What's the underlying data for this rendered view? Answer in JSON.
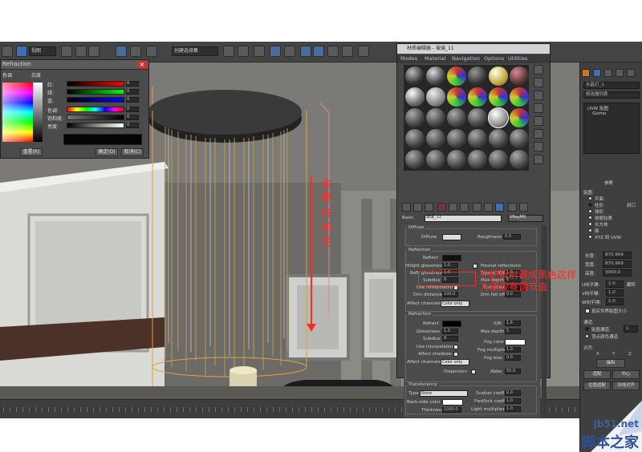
{
  "toolbar": {
    "view_dropdown": "视图",
    "selection_set_dropdown": "创建选择集"
  },
  "color_dialog": {
    "title": "Refraction",
    "label_hue": "色调",
    "label_whiteness": "白度",
    "labels": [
      "红:",
      "绿:",
      "蓝:",
      "色调:",
      "饱和度:",
      "亮度:"
    ],
    "values": [
      "0",
      "0",
      "0",
      "0",
      "0",
      "0"
    ],
    "reset_button": "重置(R)",
    "ok_button": "确定(O)",
    "cancel_button": "取消(C)"
  },
  "material_editor": {
    "title": "材质编辑器 - 玻璃_11",
    "menu": [
      "Modes",
      "Material",
      "Navigation",
      "Options",
      "Utilities"
    ],
    "material_name": "玻璃_11",
    "material_type": "VRayMtl",
    "name_label": "Basic",
    "diffuse_group": "Diffuse",
    "diffuse_label": "Diffuse",
    "roughness_label": "Roughness",
    "roughness_value": "0.0",
    "reflection_group": "Reflection",
    "reflect_label": "Reflect",
    "hilight_gloss_label": "Hilight glossiness",
    "hilight_gloss_value": "1.0",
    "refl_gloss_label": "Refl. glossiness",
    "refl_gloss_value": "1.0",
    "subdivs_label": "Subdivs",
    "subdivs_value": "8",
    "use_interp_label": "Use interpolation",
    "dim_distance_label": "Dim distance",
    "dim_distance_value": "100.0",
    "affect_channels_label": "Affect channels",
    "affect_channels_value": "Color only",
    "fresnel_label": "Fresnel reflections",
    "fresnel_ior_label": "Fresnel IOR",
    "fresnel_ior_value": "1.6",
    "max_depth_label": "Max depth",
    "max_depth_value": "5",
    "exit_color_label": "Exit color",
    "dim_falloff_label": "Dim fall off",
    "dim_falloff_value": "0.0",
    "refraction_group": "Refraction",
    "refract_label": "Refract",
    "glossiness_label": "Glossiness",
    "glossiness_value": "1.0",
    "ior_label": "IOR",
    "ior_value": "1.6",
    "refr_max_depth_value": "5",
    "refr_subdivs_value": "8",
    "refr_use_interp_label": "Use interpolation",
    "affect_shadows_label": "Affect shadows",
    "refr_affect_channels_label": "Affect channels",
    "refr_affect_channels_value": "Color only",
    "dispersion_label": "Dispersion",
    "fog_color_label": "Fog color",
    "fog_multiplier_label": "Fog multiplier",
    "fog_multiplier_value": "1.0",
    "fog_bias_label": "Fog bias",
    "fog_bias_value": "0.0",
    "abbe_label": "Abbe",
    "abbe_value": "50.0",
    "translucency_group": "Translucency",
    "type_label": "Type",
    "type_value": "None",
    "backside_color_label": "Back-side color",
    "thickness_label": "Thickness",
    "thickness_value": "1000.0",
    "scatter_coeff_label": "Scatter coeff",
    "scatter_coeff_value": "0.0",
    "fwd_bck_label": "Fwd/bck coeff",
    "fwd_bck_value": "1.0",
    "light_mult_label": "Light multiplier",
    "light_mult_value": "1.0"
  },
  "command_panel": {
    "object_name": "水晶灯_1",
    "modifier_list": "修改器列表",
    "stack_items": [
      "UVW 贴图",
      "Gizmo"
    ],
    "params_header": "参数",
    "mapping_label": "贴图:",
    "mapping_options": [
      "平面",
      "柱形",
      "封口",
      "球形",
      "收缩包裹",
      "长方体",
      "面",
      "XYZ 到 UVW"
    ],
    "length_label": "长度:",
    "length_value": "870.969",
    "width_label": "宽度:",
    "width_value": "870.969",
    "height_label": "高度:",
    "height_value": "3000.0",
    "u_tile_label": "U向平铺:",
    "v_tile_label": "V向平铺:",
    "w_tile_label": "W向平铺:",
    "tile_value": "1.0",
    "flip_label": "翻转",
    "real_world_label": "真实世界贴图大小",
    "channel_header": "通道:",
    "map_channel_label": "贴图通道:",
    "map_channel_value": "1",
    "vertex_channel_label": "顶点颜色通道",
    "align_header": "对齐:",
    "axis_labels": [
      "X",
      "Y",
      "Z"
    ],
    "buttons": [
      "操纵",
      "适配",
      "中心",
      "位图适配",
      "法线对齐"
    ]
  },
  "annotations": {
    "vertical_text": "由黑白渐变",
    "right_text": "先把折射调成黑色这样方便观察调节值"
  },
  "watermark": {
    "url": "jb51.net",
    "name": "脚本之家"
  },
  "colors": {
    "accent_red": "#ff2a2a",
    "viewport_bg": "#7c7a76",
    "panel_bg": "#474747"
  }
}
